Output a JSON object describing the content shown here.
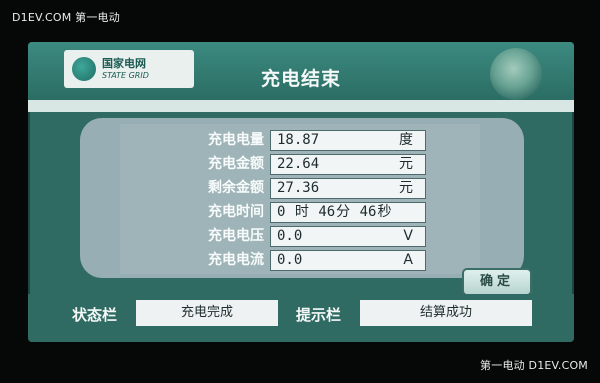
{
  "watermark": {
    "top_left": "D1EV.COM 第一电动",
    "bottom_right": "第一电动 D1EV.COM"
  },
  "header": {
    "logo_cn": "国家电网",
    "logo_en": "STATE GRID",
    "title": "充电结束"
  },
  "rows": [
    {
      "label": "充电电量",
      "value": "18.87",
      "unit": "度"
    },
    {
      "label": "充电金额",
      "value": "22.64",
      "unit": "元"
    },
    {
      "label": "剩余金额",
      "value": "27.36",
      "unit": "元"
    },
    {
      "label": "充电时间",
      "hours": "0",
      "hours_unit": "时",
      "minutes": "46",
      "minutes_unit": "分",
      "seconds": "46",
      "seconds_unit": "秒"
    },
    {
      "label": "充电电压",
      "value": "0.0",
      "unit": "V"
    },
    {
      "label": "充电电流",
      "value": "0.0",
      "unit": "A"
    }
  ],
  "confirm_button": {
    "label": "确定"
  },
  "status": {
    "status_label": "状态栏",
    "status_value": "充电完成",
    "hint_label": "提示栏",
    "hint_value": "结算成功"
  }
}
